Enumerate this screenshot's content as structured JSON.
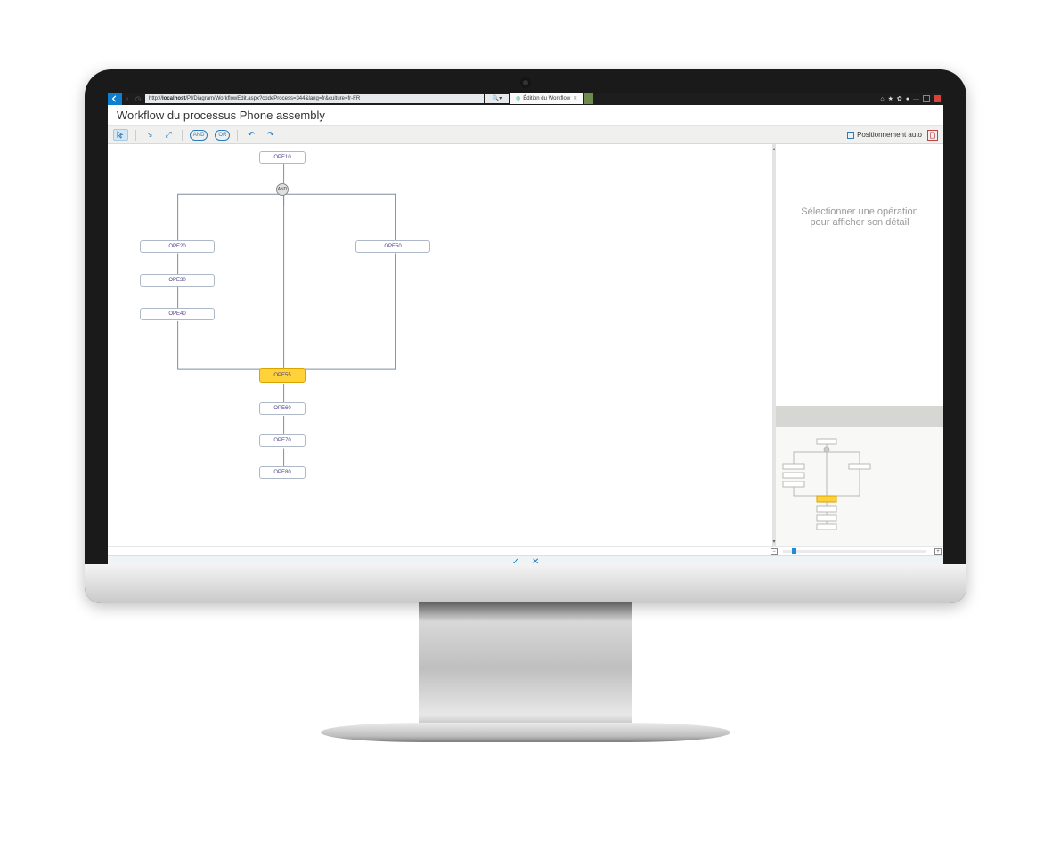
{
  "browser": {
    "url_host": "localhost",
    "url_path": "/PI/Diagram/WorkflowEdit.aspx?codeProcess=344&lang=fr&culture=fr-FR",
    "tab_title": "Édition du Workflow",
    "tab_close": "✕"
  },
  "page": {
    "title": "Workflow du processus Phone assembly"
  },
  "toolbar": {
    "cursor": "↖",
    "arrow_in": "↘",
    "fullscreen": "⤢",
    "and_label": "AND",
    "or_label": "OR",
    "undo": "↶",
    "redo": "↷",
    "auto_layout_label": "Positionnement auto",
    "pdf_icon": "⎙"
  },
  "diagram": {
    "gate_label": "AND",
    "nodes": {
      "ope10": "OPE10",
      "ope20": "OPE20",
      "ope30": "OPE30",
      "ope40": "OPE40",
      "ope50": "OPE50",
      "ope55": "OPE55",
      "ope60": "OPE60",
      "ope70": "OPE70",
      "ope80": "OPE80"
    }
  },
  "sidepanel": {
    "placeholder_line1": "Sélectionner une opération",
    "placeholder_line2": "pour afficher son détail"
  },
  "actionbar": {
    "confirm": "✓",
    "cancel": "✕"
  },
  "zoom": {
    "minus": "−",
    "plus": "+"
  },
  "sys": {
    "home": "⌂",
    "star": "★",
    "gear": "✿",
    "dot": "●",
    "min": "—"
  }
}
